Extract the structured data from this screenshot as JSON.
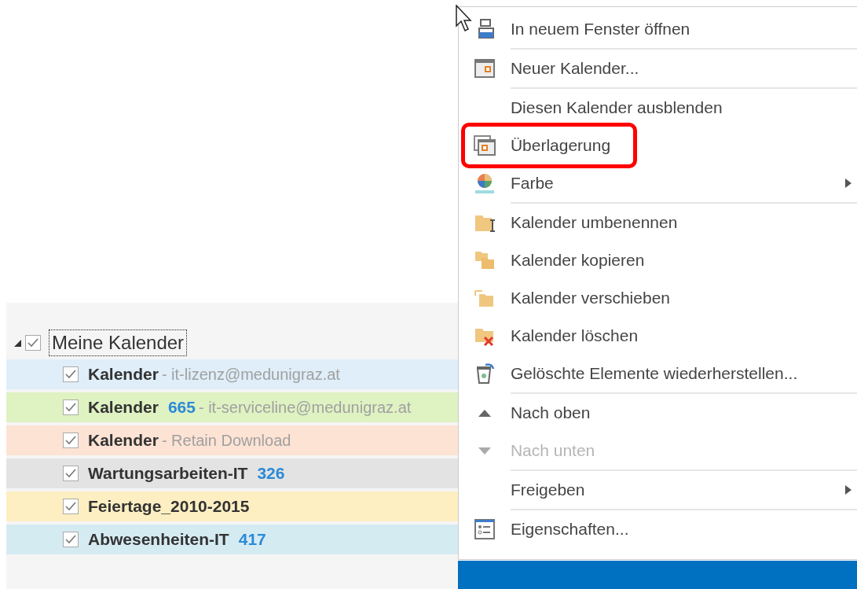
{
  "calendar_tree": {
    "group": {
      "label": "Meine Kalender",
      "expanded": true,
      "checked": true,
      "focused": true,
      "children": [
        {
          "name": "Kalender",
          "detail": "- it-lizenz@medunigraz.at",
          "checked": true,
          "color": "#dfeef8"
        },
        {
          "name": "Kalender",
          "count": "665",
          "detail": "- it-serviceline@medunigraz.at",
          "checked": true,
          "color": "#dff2c2"
        },
        {
          "name": "Kalender",
          "detail": "- Retain Download",
          "checked": true,
          "color": "#fde3d4"
        },
        {
          "name": "Wartungsarbeiten-IT",
          "count": "326",
          "checked": true,
          "color": "#e3e3e3"
        },
        {
          "name": "Feiertage_2010-2015",
          "checked": true,
          "color": "#fdefc2"
        },
        {
          "name": "Abwesenheiten-IT",
          "count": "417",
          "checked": true,
          "color": "#d5ebf2"
        }
      ]
    }
  },
  "context_menu": {
    "items": [
      {
        "kind": "open-window",
        "label": "In neuem Fenster öffnen",
        "disabled": false,
        "submenu": false,
        "highlighted": false,
        "separator_after": true
      },
      {
        "kind": "new-calendar",
        "label": "Neuer Kalender...",
        "disabled": false,
        "submenu": false,
        "highlighted": false,
        "separator_after": true
      },
      {
        "kind": "none",
        "label": "Diesen Kalender ausblenden",
        "disabled": false,
        "submenu": false,
        "highlighted": false,
        "separator_after": false
      },
      {
        "kind": "overlay",
        "label": "Überlagerung",
        "disabled": false,
        "submenu": false,
        "highlighted": true,
        "separator_after": false
      },
      {
        "kind": "color",
        "label": "Farbe",
        "disabled": false,
        "submenu": true,
        "highlighted": false,
        "separator_after": true
      },
      {
        "kind": "rename",
        "label": "Kalender umbenennen",
        "disabled": false,
        "submenu": false,
        "highlighted": false,
        "separator_after": false
      },
      {
        "kind": "copy",
        "label": "Kalender kopieren",
        "disabled": false,
        "submenu": false,
        "highlighted": false,
        "separator_after": false
      },
      {
        "kind": "move",
        "label": "Kalender verschieben",
        "disabled": false,
        "submenu": false,
        "highlighted": false,
        "separator_after": false
      },
      {
        "kind": "delete",
        "label": "Kalender löschen",
        "disabled": false,
        "submenu": false,
        "highlighted": false,
        "separator_after": false
      },
      {
        "kind": "restore",
        "label": "Gelöschte Elemente wiederherstellen...",
        "disabled": false,
        "submenu": false,
        "highlighted": false,
        "separator_after": true
      },
      {
        "kind": "up",
        "label": "Nach oben",
        "disabled": false,
        "submenu": false,
        "highlighted": false,
        "separator_after": false
      },
      {
        "kind": "down",
        "label": "Nach unten",
        "disabled": true,
        "submenu": false,
        "highlighted": false,
        "separator_after": true
      },
      {
        "kind": "none",
        "label": "Freigeben",
        "disabled": false,
        "submenu": true,
        "highlighted": false,
        "separator_after": true
      },
      {
        "kind": "properties",
        "label": "Eigenschaften...",
        "disabled": false,
        "submenu": false,
        "highlighted": false,
        "separator_after": false
      }
    ]
  }
}
